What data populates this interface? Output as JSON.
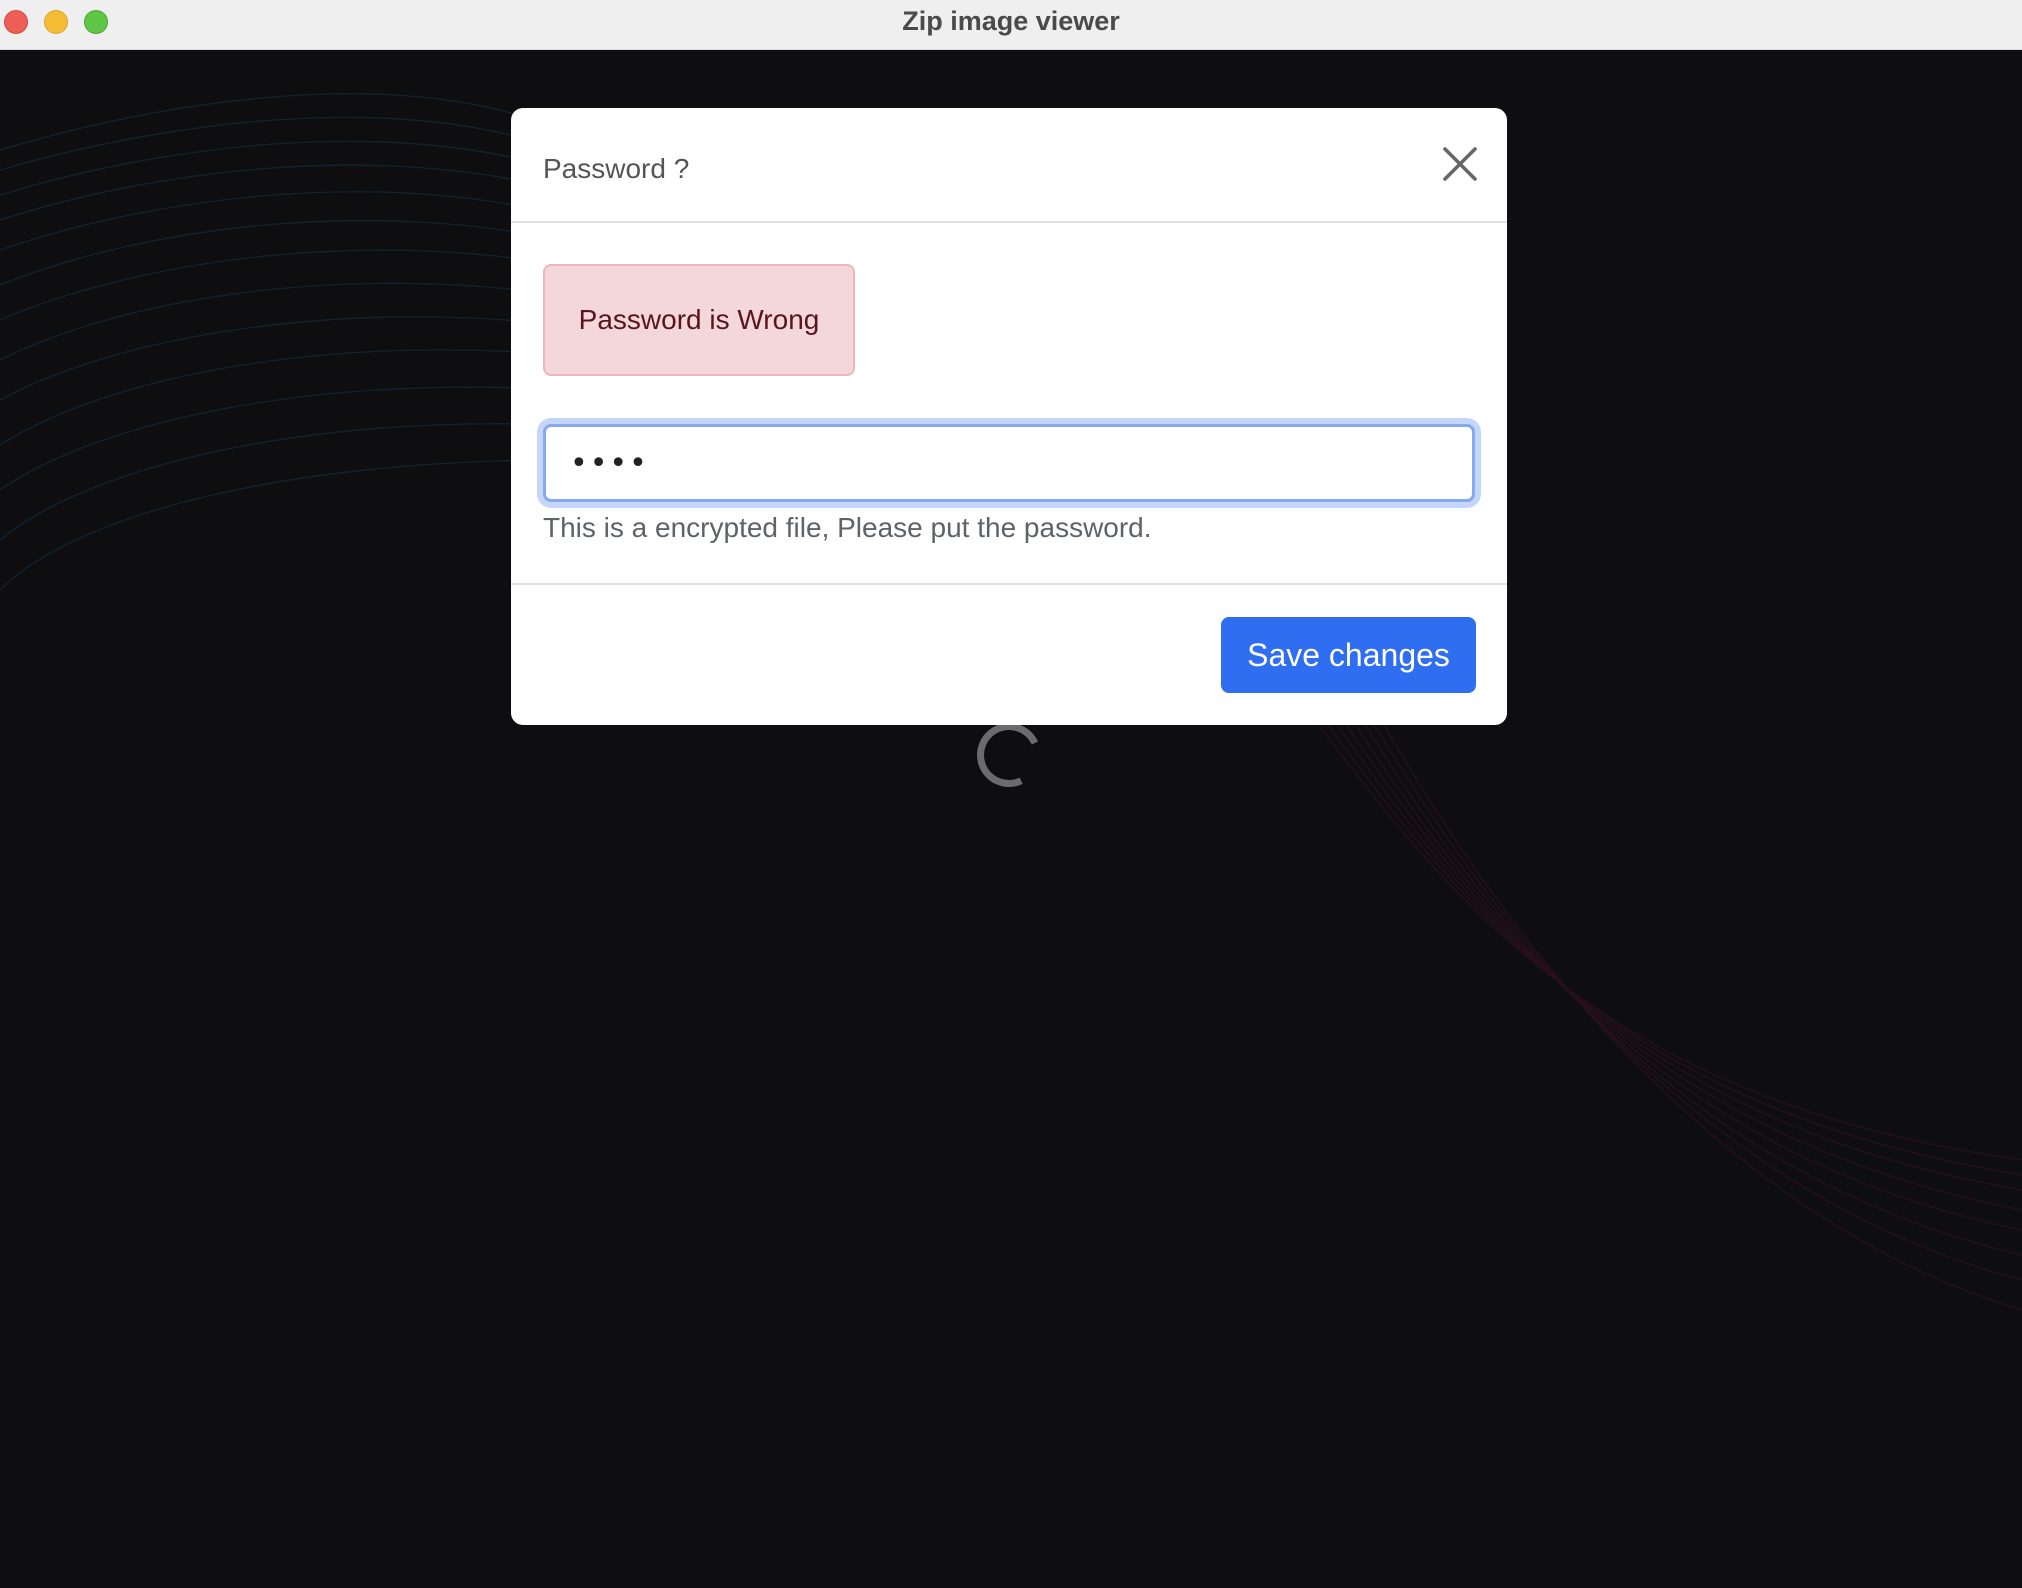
{
  "window": {
    "title": "Zip image viewer"
  },
  "modal": {
    "title": "Password ?",
    "alert_text": "Password is Wrong",
    "password_value": "••••",
    "help_text": "This is a encrypted file, Please put the password.",
    "save_label": "Save changes"
  },
  "colors": {
    "background": "#0e0e11",
    "primary": "#2f6ef0",
    "alert_bg": "#f3d7da",
    "alert_text": "#58151c"
  },
  "icons": {
    "close": "close-icon",
    "loading": "loading-spinner-icon"
  }
}
